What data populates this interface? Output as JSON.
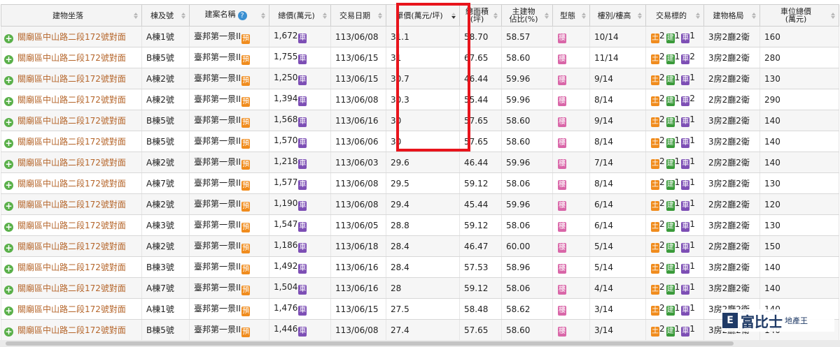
{
  "columns": [
    {
      "label": "建物坐落",
      "sortable": true
    },
    {
      "label": "棟及號",
      "sortable": true
    },
    {
      "label": "建案名稱",
      "sortable": true,
      "help": "?"
    },
    {
      "label": "總價(萬元)",
      "sortable": true
    },
    {
      "label": "交易日期",
      "sortable": true
    },
    {
      "label": "單價(萬元/坪)",
      "sortable": true,
      "sorted": "desc"
    },
    {
      "label": "總面積\n(坪)",
      "sortable": true
    },
    {
      "label": "主建物\n佔比(%)",
      "sortable": true
    },
    {
      "label": "型態",
      "sortable": true
    },
    {
      "label": "樓別/樓高",
      "sortable": true
    },
    {
      "label": "交易標的",
      "sortable": true
    },
    {
      "label": "建物格局",
      "sortable": true
    },
    {
      "label": "車位總價\n(萬元)",
      "sortable": true
    }
  ],
  "tags": {
    "car": "車",
    "presale": "預",
    "type": "樓",
    "land": "土",
    "building": "建",
    "parking": "車"
  },
  "rows": [
    {
      "address": "關廟區中山路二段172號對面",
      "unit": "A棟1號",
      "project": "臺邦第一景II",
      "total": "1,672",
      "date": "113/06/08",
      "unit_price": "31.1",
      "area": "58.70",
      "main_ratio": "58.57",
      "floor": "10/14",
      "land": "2",
      "bld": "1",
      "park": "1",
      "layout": "3房2廳2衛",
      "park_price": "160"
    },
    {
      "address": "關廟區中山路二段172號對面",
      "unit": "B棟5號",
      "project": "臺邦第一景II",
      "total": "1,755",
      "date": "113/06/15",
      "unit_price": "31",
      "area": "67.65",
      "main_ratio": "58.60",
      "floor": "11/14",
      "land": "2",
      "bld": "1",
      "park": "2",
      "layout": "3房2廳2衛",
      "park_price": "280"
    },
    {
      "address": "關廟區中山路二段172號對面",
      "unit": "A棟2號",
      "project": "臺邦第一景II",
      "total": "1,250",
      "date": "113/06/15",
      "unit_price": "30.7",
      "area": "46.44",
      "main_ratio": "59.96",
      "floor": "9/14",
      "land": "2",
      "bld": "1",
      "park": "1",
      "layout": "2房2廳2衛",
      "park_price": "130"
    },
    {
      "address": "關廟區中山路二段172號對面",
      "unit": "A棟2號",
      "project": "臺邦第一景II",
      "total": "1,394",
      "date": "113/06/08",
      "unit_price": "30.3",
      "area": "55.44",
      "main_ratio": "59.96",
      "floor": "8/14",
      "land": "2",
      "bld": "1",
      "park": "2",
      "layout": "2房2廳2衛",
      "park_price": "290"
    },
    {
      "address": "關廟區中山路二段172號對面",
      "unit": "B棟5號",
      "project": "臺邦第一景II",
      "total": "1,568",
      "date": "113/06/16",
      "unit_price": "30",
      "area": "57.65",
      "main_ratio": "58.60",
      "floor": "9/14",
      "land": "2",
      "bld": "1",
      "park": "1",
      "layout": "3房2廳2衛",
      "park_price": "140"
    },
    {
      "address": "關廟區中山路二段172號對面",
      "unit": "B棟5號",
      "project": "臺邦第一景II",
      "total": "1,570",
      "date": "113/06/06",
      "unit_price": "30",
      "area": "57.65",
      "main_ratio": "58.60",
      "floor": "8/14",
      "land": "2",
      "bld": "1",
      "park": "1",
      "layout": "3房2廳2衛",
      "park_price": "140"
    },
    {
      "address": "關廟區中山路二段172號對面",
      "unit": "A棟2號",
      "project": "臺邦第一景II",
      "total": "1,218",
      "date": "113/06/03",
      "unit_price": "29.6",
      "area": "46.44",
      "main_ratio": "59.96",
      "floor": "7/14",
      "land": "2",
      "bld": "1",
      "park": "1",
      "layout": "2房2廳2衛",
      "park_price": "140"
    },
    {
      "address": "關廟區中山路二段172號對面",
      "unit": "A棟7號",
      "project": "臺邦第一景II",
      "total": "1,577",
      "date": "113/06/08",
      "unit_price": "29.5",
      "area": "59.12",
      "main_ratio": "58.06",
      "floor": "8/14",
      "land": "2",
      "bld": "1",
      "park": "1",
      "layout": "3房2廳2衛",
      "park_price": "130"
    },
    {
      "address": "關廟區中山路二段172號對面",
      "unit": "A棟2號",
      "project": "臺邦第一景II",
      "total": "1,190",
      "date": "113/06/08",
      "unit_price": "29.4",
      "area": "45.44",
      "main_ratio": "59.96",
      "floor": "6/14",
      "land": "2",
      "bld": "1",
      "park": "1",
      "layout": "2房2廳2衛",
      "park_price": "120"
    },
    {
      "address": "關廟區中山路二段172號對面",
      "unit": "A棟3號",
      "project": "臺邦第一景II",
      "total": "1,547",
      "date": "113/06/05",
      "unit_price": "28.8",
      "area": "59.12",
      "main_ratio": "58.06",
      "floor": "6/14",
      "land": "2",
      "bld": "1",
      "park": "1",
      "layout": "3房2廳2衛",
      "park_price": "130"
    },
    {
      "address": "關廟區中山路二段172號對面",
      "unit": "A棟2號",
      "project": "臺邦第一景II",
      "total": "1,186",
      "date": "113/06/18",
      "unit_price": "28.4",
      "area": "46.47",
      "main_ratio": "60.00",
      "floor": "5/14",
      "land": "2",
      "bld": "1",
      "park": "1",
      "layout": "2房2廳2衛",
      "park_price": "150"
    },
    {
      "address": "關廟區中山路二段172號對面",
      "unit": "B棟3號",
      "project": "臺邦第一景II",
      "total": "1,492",
      "date": "113/06/16",
      "unit_price": "28.4",
      "area": "57.53",
      "main_ratio": "58.96",
      "floor": "5/14",
      "land": "2",
      "bld": "1",
      "park": "1",
      "layout": "3房2廳2衛",
      "park_price": "140"
    },
    {
      "address": "關廟區中山路二段172號對面",
      "unit": "A棟7號",
      "project": "臺邦第一景II",
      "total": "1,504",
      "date": "113/06/16",
      "unit_price": "28",
      "area": "59.12",
      "main_ratio": "58.06",
      "floor": "4/14",
      "land": "2",
      "bld": "1",
      "park": "1",
      "layout": "3房2廳2衛",
      "park_price": "140"
    },
    {
      "address": "關廟區中山路二段172號對面",
      "unit": "A棟1號",
      "project": "臺邦第一景II",
      "total": "1,476",
      "date": "113/06/15",
      "unit_price": "27.5",
      "area": "58.48",
      "main_ratio": "58.62",
      "floor": "3/14",
      "land": "2",
      "bld": "1",
      "park": "1",
      "layout": "3房2廳2衛",
      "park_price": "140"
    },
    {
      "address": "關廟區中山路二段172號對面",
      "unit": "B棟5號",
      "project": "臺邦第一景II",
      "total": "1,446",
      "date": "113/06/08",
      "unit_price": "27.4",
      "area": "57.65",
      "main_ratio": "58.60",
      "floor": "3/14",
      "land": "2",
      "bld": "1",
      "park": "1",
      "layout": "3房2廳2衛",
      "park_price": "140"
    }
  ],
  "watermark": {
    "mark": "E",
    "brand": "富比士",
    "sub": "地產王"
  },
  "colors": {
    "highlight": "#e8141c",
    "address": "#b5652a",
    "tag_orange": "#f08c1e",
    "tag_purple": "#7d4fb5",
    "tag_green": "#3a9a3a",
    "tag_pink": "#d966a8"
  }
}
